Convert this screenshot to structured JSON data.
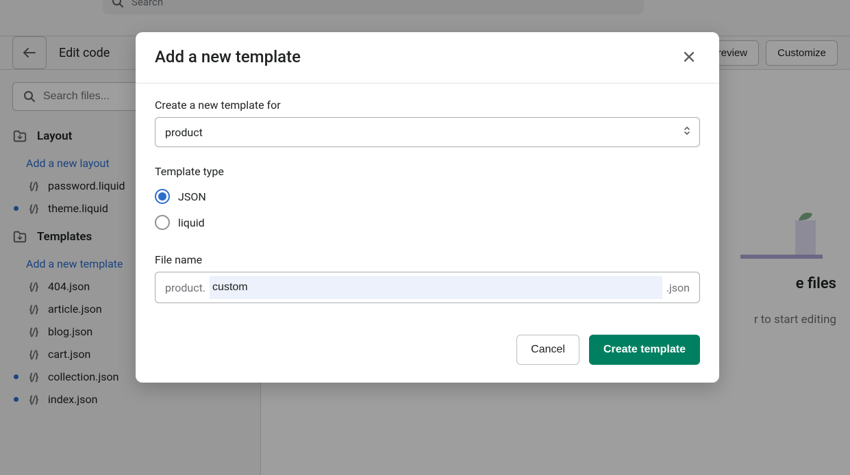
{
  "top_search": {
    "placeholder": "Search"
  },
  "toolbar": {
    "title": "Edit code",
    "preview": "Preview",
    "customize": "Customize"
  },
  "sidebar": {
    "search_placeholder": "Search files...",
    "sections": {
      "layout": {
        "title": "Layout",
        "add_link": "Add a new layout",
        "files": [
          {
            "name": "password.liquid",
            "dot": false
          },
          {
            "name": "theme.liquid",
            "dot": true
          }
        ]
      },
      "templates": {
        "title": "Templates",
        "add_link": "Add a new template",
        "files": [
          {
            "name": "404.json",
            "dot": false
          },
          {
            "name": "article.json",
            "dot": false
          },
          {
            "name": "blog.json",
            "dot": false
          },
          {
            "name": "cart.json",
            "dot": false
          },
          {
            "name": "collection.json",
            "dot": true
          },
          {
            "name": "index.json",
            "dot": true
          }
        ]
      }
    }
  },
  "main": {
    "heading": "e files",
    "sub": "r to start editing"
  },
  "modal": {
    "title": "Add a new template",
    "template_for_label": "Create a new template for",
    "template_for_value": "product",
    "type_label": "Template type",
    "type_options": {
      "json": "JSON",
      "liquid": "liquid"
    },
    "type_selected": "json",
    "filename_label": "File name",
    "filename_prefix": "product.",
    "filename_value": "custom",
    "filename_suffix": ".json",
    "cancel": "Cancel",
    "create": "Create template"
  }
}
